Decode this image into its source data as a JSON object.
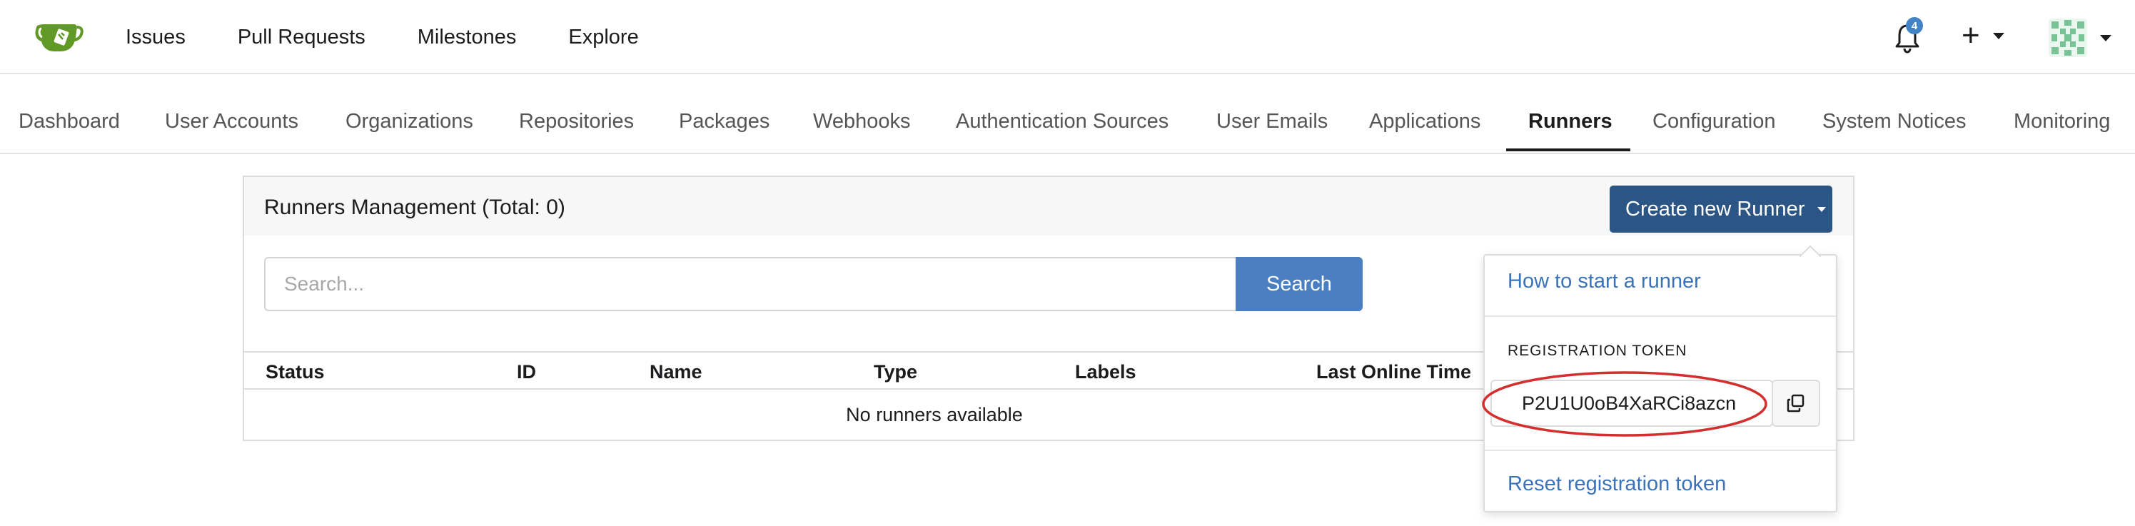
{
  "topnav": {
    "links": [
      "Issues",
      "Pull Requests",
      "Milestones",
      "Explore"
    ],
    "notification_count": "4",
    "plus_symbol": "+"
  },
  "admin_tabs": [
    "Dashboard",
    "User Accounts",
    "Organizations",
    "Repositories",
    "Packages",
    "Webhooks",
    "Authentication Sources",
    "User Emails",
    "Applications",
    "Runners",
    "Configuration",
    "System Notices",
    "Monitoring"
  ],
  "active_tab": "Runners",
  "runners": {
    "title": "Runners Management (Total: 0)",
    "create_button_label": "Create new Runner",
    "search_placeholder": "Search...",
    "search_button_label": "Search",
    "columns": [
      "Status",
      "ID",
      "Name",
      "Type",
      "Labels",
      "Last Online Time"
    ],
    "empty_message": "No runners available"
  },
  "dropdown": {
    "how_to_link": "How to start a runner",
    "token_header": "REGISTRATION TOKEN",
    "token_value": "P2U1U0oB4XaRCi8azcn",
    "reset_link": "Reset registration token"
  },
  "colors": {
    "primary_button": "#2a5585",
    "search_button": "#4a7fc1",
    "link": "#3a73b9",
    "highlight": "#d32f2f",
    "logo_green": "#609926"
  },
  "icons": [
    "gitea-logo-icon",
    "bell-icon",
    "plus-icon",
    "avatar",
    "copy-icon",
    "caret-down-icon"
  ]
}
